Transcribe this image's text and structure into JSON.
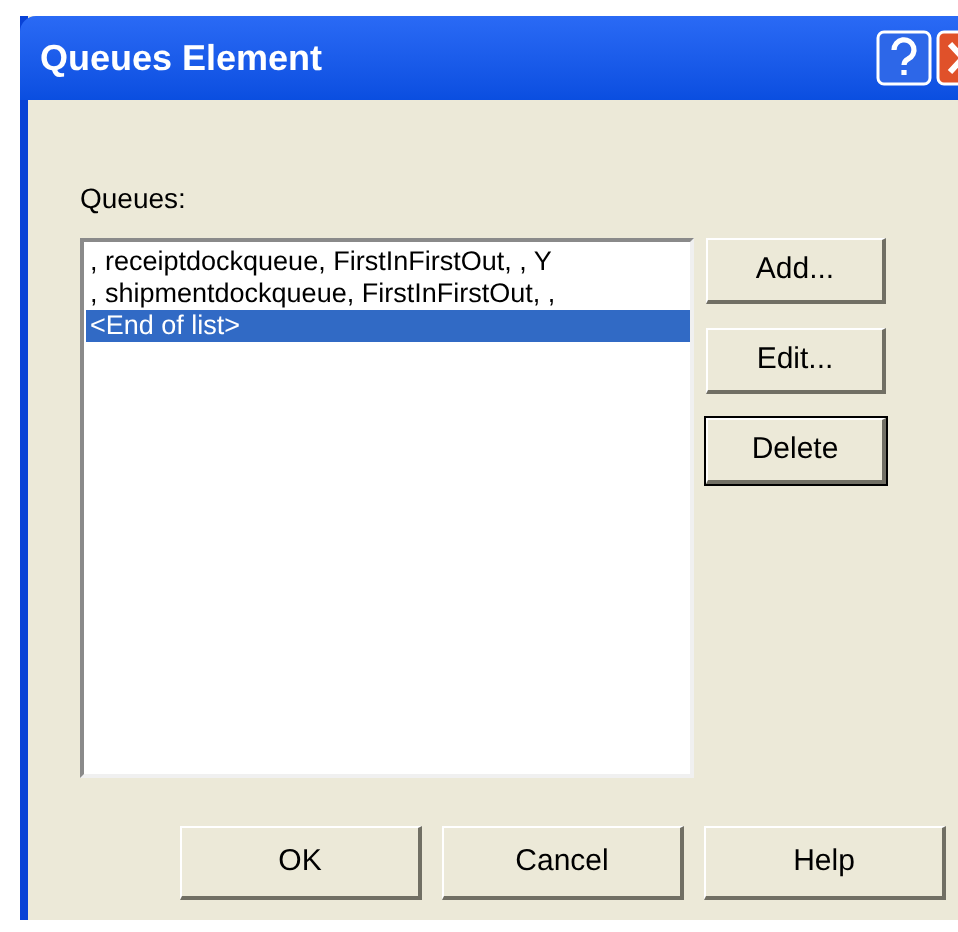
{
  "window": {
    "title": "Queues Element"
  },
  "queues": {
    "label": "Queues:",
    "items": [
      {
        "text": ", receiptdockqueue, FirstInFirstOut, , Y",
        "selected": false
      },
      {
        "text": ", shipmentdockqueue, FirstInFirstOut, ,",
        "selected": false
      },
      {
        "text": "<End of list>",
        "selected": true
      }
    ]
  },
  "side_buttons": [
    {
      "label": "Add...",
      "focused": false
    },
    {
      "label": "Edit...",
      "focused": false
    },
    {
      "label": "Delete",
      "focused": true
    }
  ],
  "buttons": [
    "OK",
    "Cancel",
    "Help"
  ]
}
